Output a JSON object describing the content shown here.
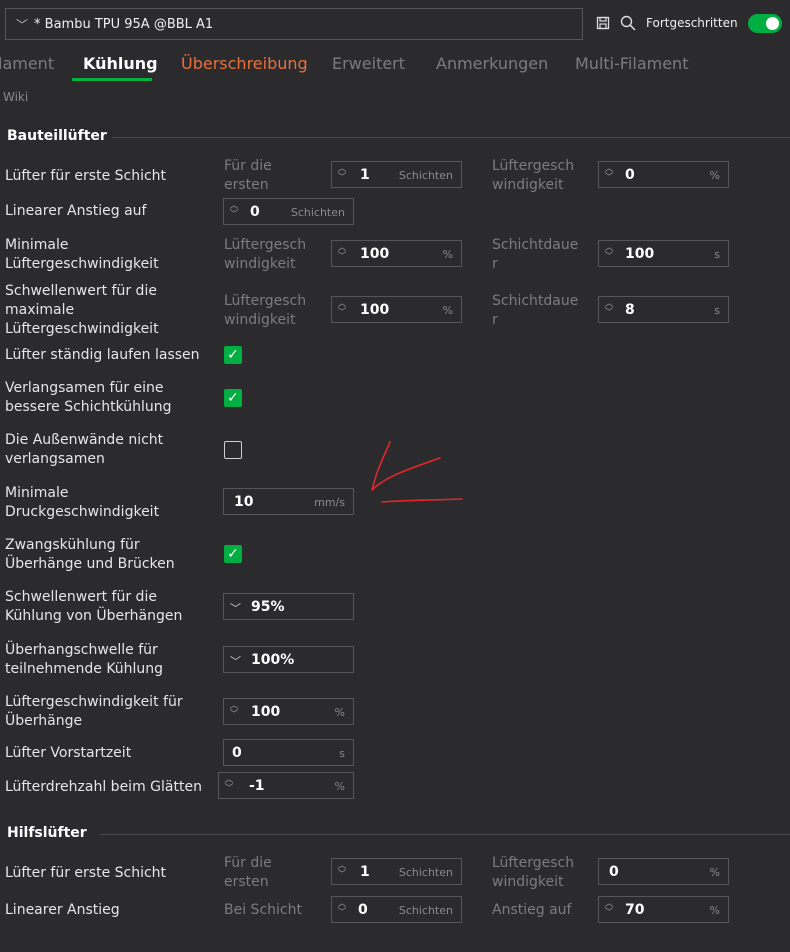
{
  "header": {
    "preset_name": "* Bambu TPU 95A @BBL A1",
    "advanced_label": "Fortgeschritten"
  },
  "tabs": [
    "lament",
    "Kühlung",
    "Überschreibung",
    "Erweitert",
    "Anmerkungen",
    "Multi-Filament"
  ],
  "wiki_label": "Wiki",
  "bauteil": {
    "title": "Bauteillüfter",
    "row1": {
      "label": "Lüfter für erste Schicht",
      "sub1a": "Für die",
      "sub1b": "ersten",
      "v1": "1",
      "u1": "Schichten",
      "sub2a": "Lüftergesch",
      "sub2b": "windigkeit",
      "v2": "0",
      "u2": "%"
    },
    "row2": {
      "label": "Linearer Anstieg auf",
      "v1": "0",
      "u1": "Schichten"
    },
    "row3": {
      "label_a": "Minimale",
      "label_b": "Lüftergeschwindigkeit",
      "sub1a": "Lüftergesch",
      "sub1b": "windigkeit",
      "v1": "100",
      "u1": "%",
      "sub2a": "Schichtdaue",
      "sub2b": "r",
      "v2": "100",
      "u2": "s"
    },
    "row4": {
      "label_a": "Schwellenwert für die",
      "label_b": "maximale",
      "label_c": "Lüftergeschwindigkeit",
      "sub1a": "Lüftergesch",
      "sub1b": "windigkeit",
      "v1": "100",
      "u1": "%",
      "sub2a": "Schichtdaue",
      "sub2b": "r",
      "v2": "8",
      "u2": "s"
    },
    "row5": {
      "label": "Lüfter ständig laufen lassen"
    },
    "row6": {
      "label_a": "Verlangsamen für eine",
      "label_b": "bessere Schichtkühlung"
    },
    "row7": {
      "label_a": "Die Außenwände nicht",
      "label_b": "verlangsamen"
    },
    "row8": {
      "label_a": "Minimale",
      "label_b": "Druckgeschwindigkeit",
      "v1": "10",
      "u1": "mm/s"
    },
    "row9": {
      "label_a": "Zwangskühlung für",
      "label_b": "Überhänge und Brücken"
    },
    "row10": {
      "label_a": "Schwellenwert für die",
      "label_b": "Kühlung von Überhängen",
      "v1": "95%"
    },
    "row11": {
      "label_a": "Überhangschwelle für",
      "label_b": "teilnehmende Kühlung",
      "v1": "100%"
    },
    "row12": {
      "label_a": "Lüftergeschwindigkeit für",
      "label_b": "Überhänge",
      "v1": "100",
      "u1": "%"
    },
    "row13": {
      "label": "Lüfter Vorstartzeit",
      "v1": "0",
      "u1": "s"
    },
    "row14": {
      "label": "Lüfterdrehzahl beim Glätten",
      "v1": "-1",
      "u1": "%"
    }
  },
  "hilfs": {
    "title": "Hilfslüfter",
    "row1": {
      "label": "Lüfter für erste Schicht",
      "sub1a": "Für die",
      "sub1b": "ersten",
      "v1": "1",
      "u1": "Schichten",
      "sub2a": "Lüftergesch",
      "sub2b": "windigkeit",
      "v2": "0",
      "u2": "%"
    },
    "row2": {
      "label": "Linearer Anstieg",
      "sub1": "Bei Schicht",
      "v1": "0",
      "u1": "Schichten",
      "sub2": "Anstieg auf",
      "v2": "70",
      "u2": "%"
    }
  },
  "colors": {
    "accent": "#00ae42",
    "override": "#e8703a",
    "background": "#2b2b2e",
    "annotation": "#e0262b"
  }
}
